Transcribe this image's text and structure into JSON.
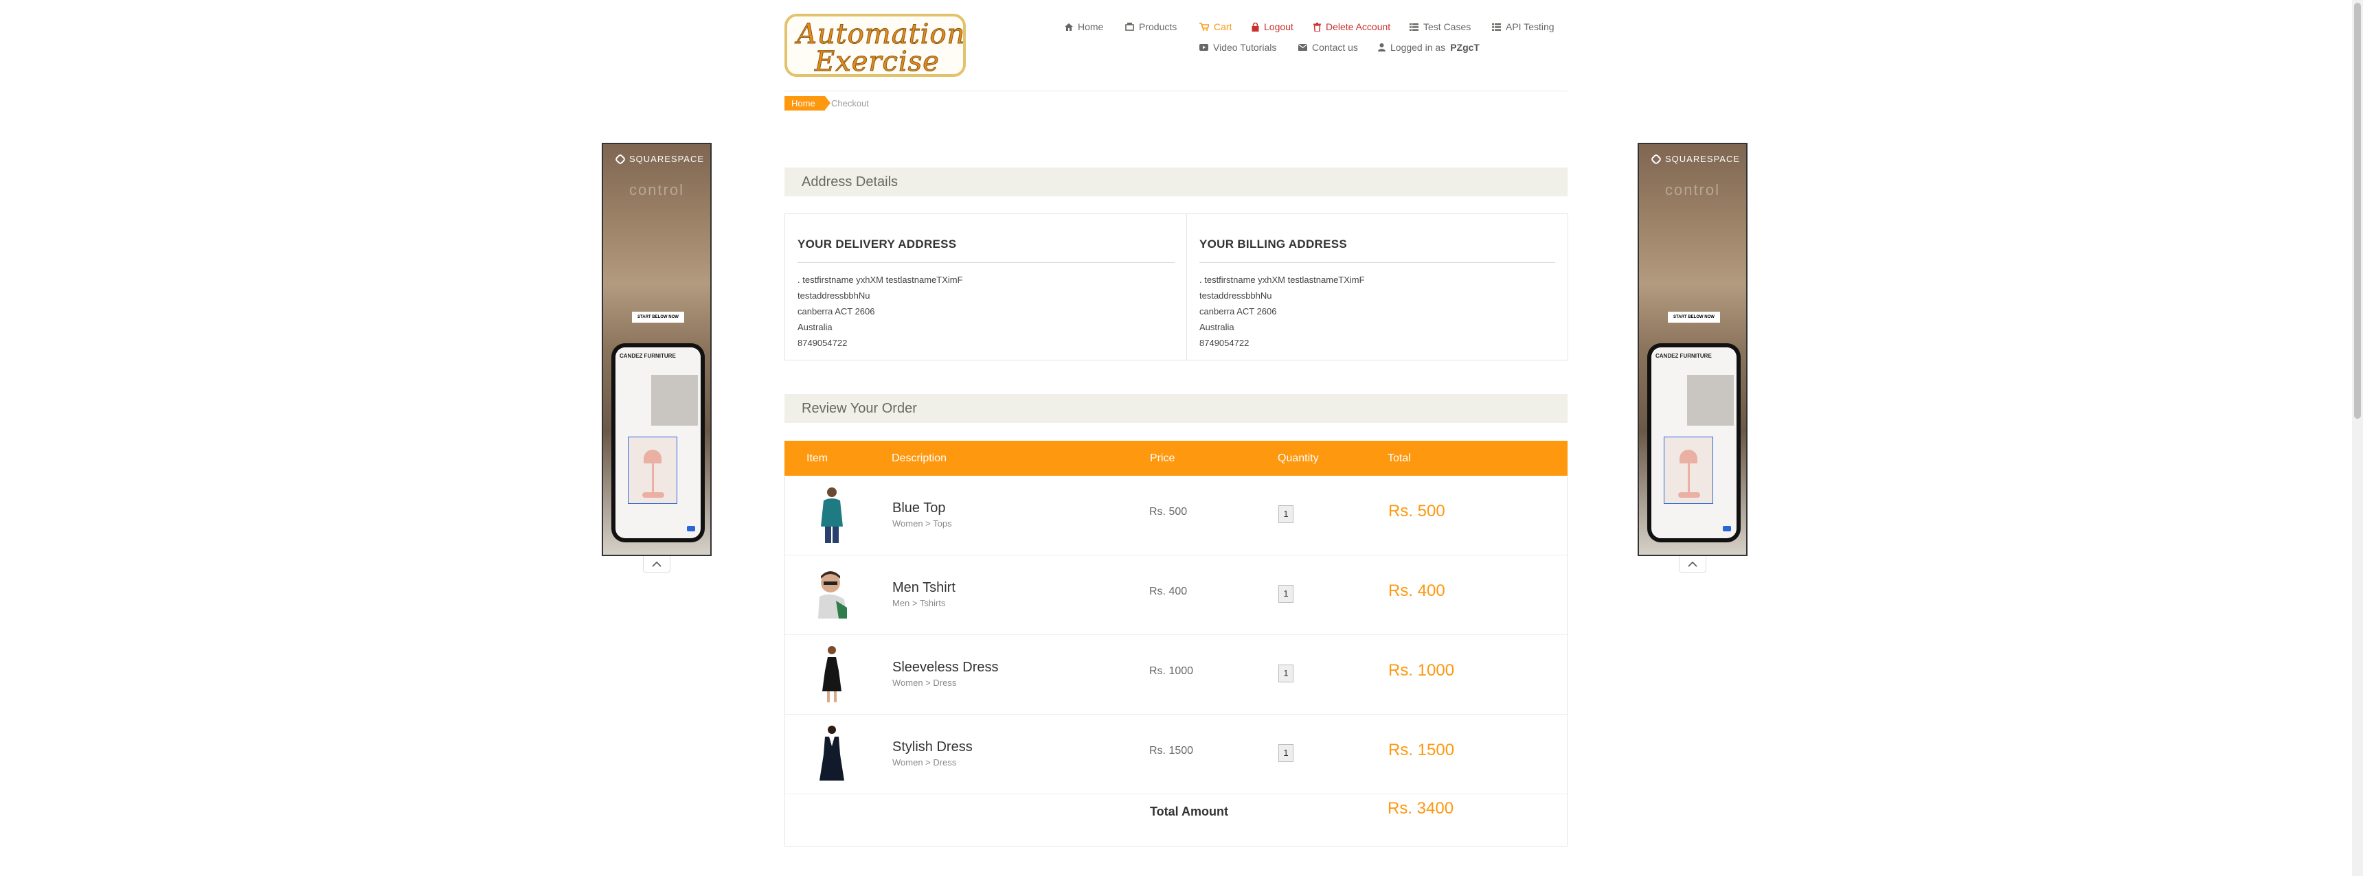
{
  "header": {
    "logo_line1": "Automation",
    "logo_line2": "Exercise",
    "nav": [
      {
        "label": "Home",
        "icon": "home-icon"
      },
      {
        "label": "Products",
        "icon": "products-icon"
      },
      {
        "label": "Cart",
        "icon": "cart-icon"
      },
      {
        "label": "Logout",
        "icon": "lock-icon"
      },
      {
        "label": "Delete Account",
        "icon": "trash-icon"
      },
      {
        "label": "Test Cases",
        "icon": "list-icon"
      },
      {
        "label": "API Testing",
        "icon": "list-icon"
      },
      {
        "label": "Video Tutorials",
        "icon": "youtube-icon"
      },
      {
        "label": "Contact us",
        "icon": "envelope-icon"
      }
    ],
    "logged_in_prefix": "Logged in as",
    "logged_in_user": "PZgcT",
    "colors": {
      "accent": "#fe980f",
      "danger": "#c9302c"
    }
  },
  "breadcrumb": {
    "home": "Home",
    "current": "Checkout"
  },
  "address_section": {
    "title": "Address Details",
    "delivery": {
      "title": "YOUR DELIVERY ADDRESS",
      "lines": [
        ". testfirstname yxhXM testlastnameTXimF",
        "testaddressbbhNu",
        "canberra ACT 2606",
        "Australia",
        "8749054722"
      ]
    },
    "billing": {
      "title": "YOUR BILLING ADDRESS",
      "lines": [
        ". testfirstname yxhXM testlastnameTXimF",
        "testaddressbbhNu",
        "canberra ACT 2606",
        "Australia",
        "8749054722"
      ]
    }
  },
  "order_section": {
    "title": "Review Your Order",
    "columns": [
      "Item",
      "Description",
      "Price",
      "Quantity",
      "Total"
    ],
    "items": [
      {
        "name": "Blue Top",
        "category": "Women > Tops",
        "price": "Rs. 500",
        "quantity": "1",
        "total": "Rs. 500"
      },
      {
        "name": "Men Tshirt",
        "category": "Men > Tshirts",
        "price": "Rs. 400",
        "quantity": "1",
        "total": "Rs. 400"
      },
      {
        "name": "Sleeveless Dress",
        "category": "Women > Dress",
        "price": "Rs. 1000",
        "quantity": "1",
        "total": "Rs. 1000"
      },
      {
        "name": "Stylish Dress",
        "category": "Women > Dress",
        "price": "Rs. 1500",
        "quantity": "1",
        "total": "Rs. 1500"
      }
    ],
    "total_label": "Total Amount",
    "total_value": "Rs. 3400"
  },
  "ads": {
    "brand": "SQUARESPACE",
    "ghost_text": "control",
    "cta": "START BELOW NOW",
    "screen_heading": "CANDEZ FURNITURE"
  }
}
